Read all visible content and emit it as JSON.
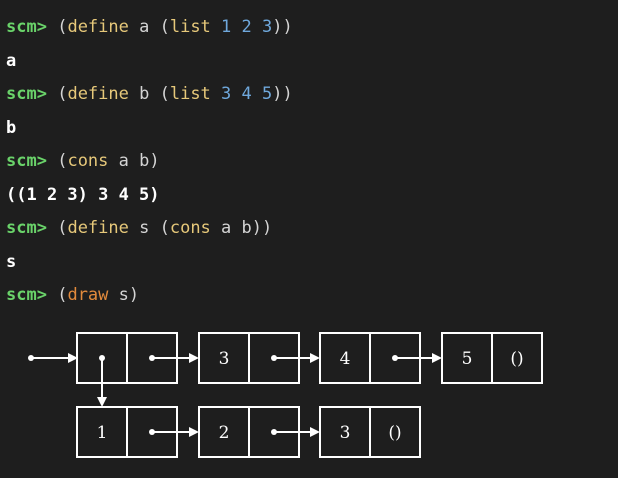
{
  "terminal": {
    "prompt": "scm>",
    "lines": [
      {
        "kind": "input",
        "open": "(",
        "keyword": "define",
        "sym": " a ",
        "open2": "(",
        "kw2": "list",
        "nums": " 1 2 3",
        "close": "))"
      },
      {
        "kind": "output",
        "text": "a"
      },
      {
        "kind": "input",
        "open": "(",
        "keyword": "define",
        "sym": " b ",
        "open2": "(",
        "kw2": "list",
        "nums": " 3 4 5",
        "close": "))"
      },
      {
        "kind": "output",
        "text": "b"
      },
      {
        "kind": "input",
        "open": "(",
        "keyword": "cons",
        "sym": " a b",
        "close": ")"
      },
      {
        "kind": "output",
        "text": "((1 2 3) 3 4 5)"
      },
      {
        "kind": "input",
        "open": "(",
        "keyword": "define",
        "sym": " s ",
        "open2": "(",
        "kw2": "cons",
        "sym2": " a b",
        "close": "))"
      },
      {
        "kind": "output",
        "text": "s"
      },
      {
        "kind": "input",
        "open": "(",
        "keyword": "draw",
        "sym": " s",
        "close": ")"
      }
    ]
  },
  "diagram": {
    "top_row": [
      "",
      "3",
      "4",
      "5"
    ],
    "top_row_tail": "()",
    "bottom_row": [
      "1",
      "2",
      "3"
    ],
    "bottom_row_tail": "()"
  },
  "colors": {
    "background": "#1e1e1e",
    "prompt": "#6ad36a",
    "keyword": "#e6c87a",
    "draw_keyword": "#e28a3c",
    "number": "#6fa8dc",
    "text": "#d4d4d4",
    "box": "#ffffff"
  }
}
